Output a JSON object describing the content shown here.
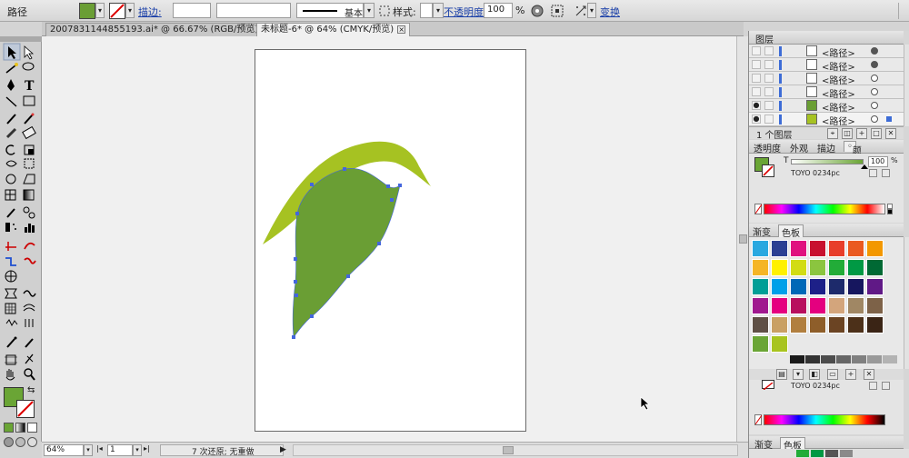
{
  "control_bar": {
    "selection_label": "路径",
    "stroke_label": "描边:",
    "stroke_profile": "基本",
    "style_label": "样式:",
    "opacity_label": "不透明度:",
    "opacity_value": "100",
    "opacity_unit": "%",
    "transform_label": "变换"
  },
  "tabs": [
    {
      "label": "2007831144855193.ai* @ 66.67% (RGB/预览)",
      "active": false
    },
    {
      "label": "未标题-6* @ 64% (CMYK/预览)",
      "active": true
    }
  ],
  "status_bar": {
    "zoom": "64%",
    "page": "1",
    "message": "7 次还原; 无重做"
  },
  "layers_panel": {
    "title": "图层",
    "rows": [
      {
        "name": "<路径>"
      },
      {
        "name": "<路径>"
      },
      {
        "name": "<路径>"
      },
      {
        "name": "<路径>"
      },
      {
        "name": "<路径>"
      },
      {
        "name": "<路径>"
      }
    ],
    "footer": "1 个图层"
  },
  "color_panel": {
    "tabs": [
      "透明度",
      "外观",
      "描边",
      "颜色"
    ],
    "active_tab": "颜色",
    "channel_label": "T",
    "tint_value": "100",
    "tint_unit": "%",
    "swatch_name": "TOYO 0234pc",
    "fill_color": "#6aa535"
  },
  "swatches_panel": {
    "tabs": [
      "渐变",
      "色板"
    ],
    "colors": [
      "#29a8e0",
      "#2b3f93",
      "#e0117f",
      "#c8102e",
      "#e83e2a",
      "#ea5a20",
      "#f39800",
      "#f5b526",
      "#fff100",
      "#d2dc13",
      "#8bc53f",
      "#22ac38",
      "#009944",
      "#006934",
      "#009e96",
      "#00a0e9",
      "#0068b7",
      "#1d2088",
      "#1d2a6b",
      "#16165e",
      "#601986",
      "#a0198f",
      "#e5007f",
      "#b80f5e",
      "#e4007f",
      "#d3a57c",
      "#a08764",
      "#7d6248",
      "#5f5046",
      "#c9a063",
      "#b17f3f",
      "#8e5e2a",
      "#6b4423",
      "#4c3019",
      "#3a2415",
      "#6aa535",
      "#a8c41f"
    ],
    "grays": [
      "#1a1a1a",
      "#333333",
      "#4d4d4d",
      "#666666",
      "#808080",
      "#999999",
      "#b3b3b3"
    ],
    "swatch_name": "TOYO 0234pc"
  },
  "bottom_panel": {
    "tabs": [
      "渐变",
      "色板"
    ]
  },
  "artwork": {
    "leaf_dark": "#6a9e34",
    "leaf_light": "#a6c222",
    "anchor_color": "#4466dd"
  }
}
